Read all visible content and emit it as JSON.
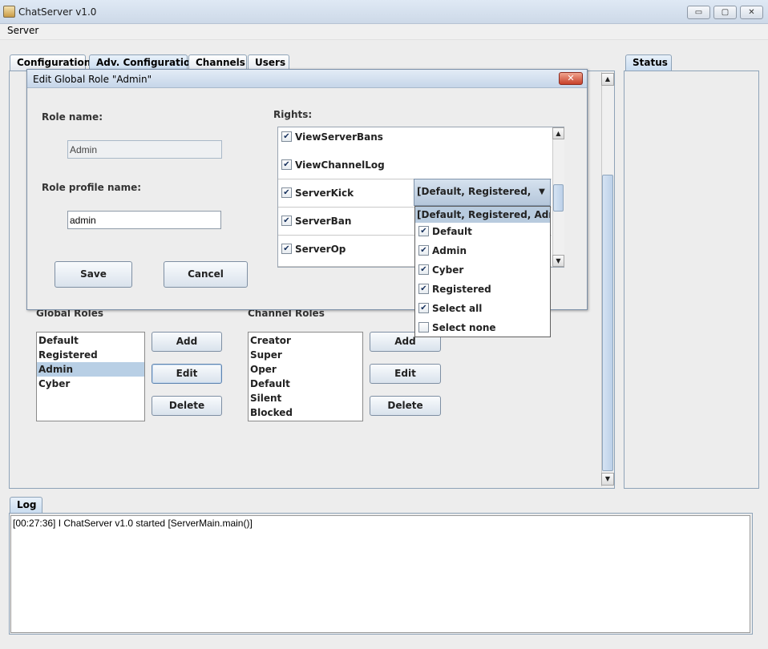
{
  "window": {
    "title": "ChatServer v1.0",
    "minimize": "▭",
    "maximize": "▢",
    "close": "✕"
  },
  "menu": {
    "server": "Server"
  },
  "tabs": [
    {
      "label": "Configuration"
    },
    {
      "label": "Adv. Configuration"
    },
    {
      "label": "Channels"
    },
    {
      "label": "Users"
    }
  ],
  "status_tab": "Status",
  "main": {
    "global_roles_label": "Global Roles",
    "channel_roles_label": "Channel Roles",
    "global_roles": [
      "Default",
      "Registered",
      "Admin",
      "Cyber"
    ],
    "global_roles_selected": "Admin",
    "channel_roles": [
      "Creator",
      "Super",
      "Oper",
      "Default",
      "Silent",
      "Blocked"
    ],
    "buttons": {
      "add": "Add",
      "edit": "Edit",
      "delete": "Delete"
    }
  },
  "log": {
    "tab": "Log",
    "lines": [
      "[00:27:36] I ChatServer v1.0 started [ServerMain.main()]"
    ]
  },
  "dialog": {
    "title": "Edit Global Role \"Admin\"",
    "close": "✕",
    "role_name_label": "Role name:",
    "role_name_value": "Admin",
    "role_profile_label": "Role profile name:",
    "role_profile_value": "admin",
    "save": "Save",
    "cancel": "Cancel",
    "rights_label": "Rights:",
    "rights": [
      {
        "name": "ViewServerBans",
        "checked": true
      },
      {
        "name": "ViewChannelLog",
        "checked": true
      },
      {
        "name": "ServerKick",
        "checked": true
      },
      {
        "name": "ServerBan",
        "checked": true
      },
      {
        "name": "ServerOp",
        "checked": true
      }
    ],
    "combo_value": "[Default, Registered, Ad...",
    "popup": {
      "header": "[Default, Registered, Admin, Cyber]",
      "items": [
        {
          "label": "Default",
          "checked": true
        },
        {
          "label": "Admin",
          "checked": true
        },
        {
          "label": "Cyber",
          "checked": true
        },
        {
          "label": "Registered",
          "checked": true
        },
        {
          "label": "Select all",
          "checked": true
        },
        {
          "label": "Select none",
          "checked": false
        }
      ]
    },
    "checkmark": "✔"
  }
}
